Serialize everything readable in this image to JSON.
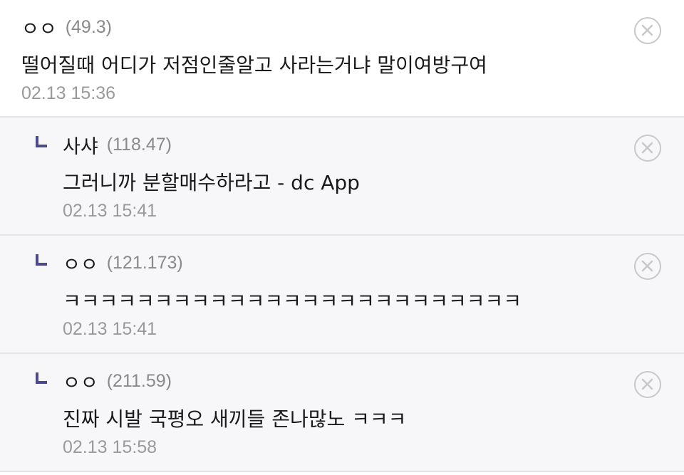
{
  "comments": [
    {
      "nick": "ㅇㅇ",
      "ip": "(49.3)",
      "text": "떨어질때 어디가 저점인줄알고 사라는거냐 말이여방구여",
      "date": "02.13 15:36"
    },
    {
      "nick": "사샤",
      "ip": "(118.47)",
      "text": "그러니까 분할매수하라고 - dc App",
      "date": "02.13 15:41"
    },
    {
      "nick": "ㅇㅇ",
      "ip": "(121.173)",
      "text": "ㅋㅋㅋㅋㅋㅋㅋㅋㅋㅋㅋㅋㅋㅋㅋㅋㅋㅋㅋㅋㅋㅋㅋㅋㅋ",
      "date": "02.13 15:41"
    },
    {
      "nick": "ㅇㅇ",
      "ip": "(211.59)",
      "text": "진짜 시발 국평오 새끼들 존나많노 ㅋㅋㅋ",
      "date": "02.13 15:58"
    }
  ],
  "icons": {
    "reply": "reply-arrow-icon",
    "delete": "close-circle-icon"
  },
  "colors": {
    "reply_background": "#f7f7fa",
    "reply_marker": "#4a4a8c",
    "meta_text": "#8a8a8a"
  }
}
